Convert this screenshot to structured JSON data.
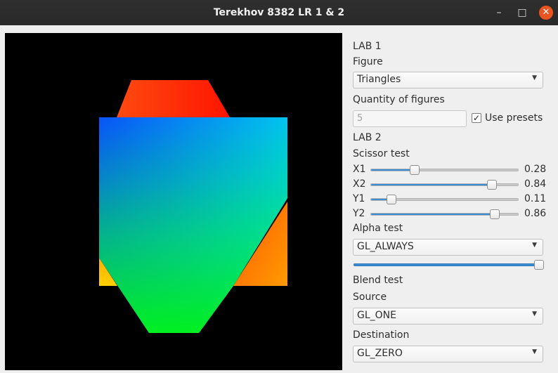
{
  "window": {
    "title": "Terekhov 8382 LR 1 & 2",
    "minimize": "–",
    "maximize": "□",
    "close": "✕"
  },
  "canvas": {
    "background": "#000000"
  },
  "lab1": {
    "header": "LAB 1",
    "figure_label": "Figure",
    "figure_value": "Triangles",
    "quantity_label": "Quantity of figures",
    "quantity_value": "5",
    "use_presets_label": "Use presets",
    "use_presets_checked": true,
    "check_mark": "✓"
  },
  "lab2": {
    "header": "LAB 2",
    "scissor_label": "Scissor test",
    "sliders": [
      {
        "label": "X1",
        "value": "0.28",
        "level": 0.28
      },
      {
        "label": "X2",
        "value": "0.84",
        "level": 0.84
      },
      {
        "label": "Y1",
        "value": "0.11",
        "level": 0.11
      },
      {
        "label": "Y2",
        "value": "0.86",
        "level": 0.86
      }
    ],
    "alpha_label": "Alpha test",
    "alpha_value": "GL_ALWAYS",
    "alpha_level": 1.0,
    "blend_label": "Blend test",
    "source_label": "Source",
    "source_value": "GL_ONE",
    "destination_label": "Destination",
    "destination_value": "GL_ZERO"
  },
  "icons": {
    "dropdown": "caret-down-icon",
    "close": "close-icon",
    "minimize": "minimize-icon",
    "maximize": "maximize-icon",
    "checkbox": "checkbox-icon"
  },
  "colors": {
    "accent": "#3c8ed4",
    "close": "#e95420",
    "titlebar": "#2c2c2c"
  }
}
